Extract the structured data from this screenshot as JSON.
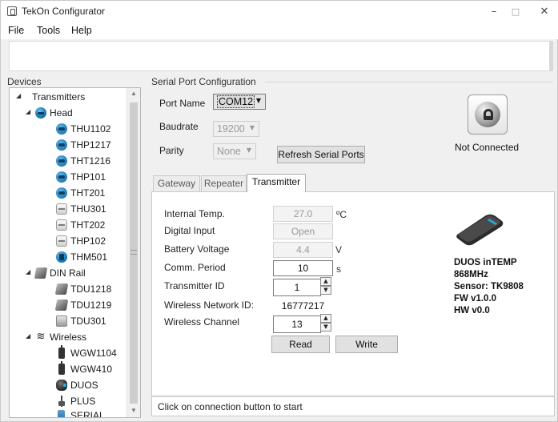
{
  "window": {
    "title": "TekOn Configurator",
    "minimize": "–",
    "maximize": "□",
    "close": "✕"
  },
  "menu": {
    "file": "File",
    "tools": "Tools",
    "help": "Help"
  },
  "devices": {
    "label": "Devices",
    "tree": [
      {
        "label": "Transmitters",
        "expander": "◢",
        "icon": "none"
      },
      {
        "label": "Head",
        "expander": "◢",
        "icon": "head-sensor-icon"
      },
      {
        "label": "THU1102",
        "icon": "blue-sensor-icon"
      },
      {
        "label": "THP1217",
        "icon": "blue-sensor-icon"
      },
      {
        "label": "THT1216",
        "icon": "blue-sensor-icon"
      },
      {
        "label": "THP101",
        "icon": "blue-sensor-icon"
      },
      {
        "label": "THT201",
        "icon": "blue-sensor-icon"
      },
      {
        "label": "THU301",
        "icon": "white-sensor-icon"
      },
      {
        "label": "THT202",
        "icon": "white-sensor-icon"
      },
      {
        "label": "THP102",
        "icon": "white-sensor-icon"
      },
      {
        "label": "THM501",
        "icon": "blue-module-icon"
      },
      {
        "label": "DIN Rail",
        "expander": "◢",
        "icon": "din-rail-icon"
      },
      {
        "label": "TDU1218",
        "icon": "din-rail-icon"
      },
      {
        "label": "TDU1219",
        "icon": "din-rail-icon"
      },
      {
        "label": "TDU301",
        "icon": "din-flat-icon"
      },
      {
        "label": "Wireless",
        "expander": "◢",
        "icon": "wifi-icon"
      },
      {
        "label": "WGW1104",
        "icon": "gateway-icon"
      },
      {
        "label": "WGW410",
        "icon": "gateway-icon"
      },
      {
        "label": "DUOS",
        "icon": "duos-icon"
      },
      {
        "label": "PLUS",
        "icon": "plus-icon"
      },
      {
        "label": "SERIAL",
        "icon": "serial-icon"
      }
    ]
  },
  "serial": {
    "section_label": "Serial Port Configuration",
    "port_name_label": "Port Name",
    "port_name_value": "COM12",
    "baudrate_label": "Baudrate",
    "baudrate_value": "19200",
    "parity_label": "Parity",
    "parity_value": "None",
    "refresh_label": "Refresh Serial Ports",
    "connection_status": "Not Connected"
  },
  "tabs": [
    "Gateway",
    "Repeater",
    "Transmitter"
  ],
  "selected_tab": "Transmitter",
  "transmitter": {
    "internal_temp_label": "Internal Temp.",
    "internal_temp_value": "27.0",
    "internal_temp_unit": "ºC",
    "digital_input_label": "Digital Input",
    "digital_input_value": "Open",
    "battery_label": "Battery Voltage",
    "battery_value": "4.4",
    "battery_unit": "V",
    "comm_period_label": "Comm. Period",
    "comm_period_value": "10",
    "comm_period_unit": "s",
    "transmitter_id_label": "Transmitter ID",
    "transmitter_id_value": "1",
    "network_id_label": "Wireless Network ID:",
    "network_id_value": "16777217",
    "channel_label": "Wireless Channel",
    "channel_value": "13",
    "read_label": "Read",
    "write_label": "Write"
  },
  "device_info": {
    "line1": "DUOS inTEMP",
    "line2": "868MHz",
    "line3": "Sensor: TK9808",
    "line4": "FW v1.0.0",
    "line5": "HW v0.0"
  },
  "status": {
    "message": "Click on connection button to start"
  }
}
